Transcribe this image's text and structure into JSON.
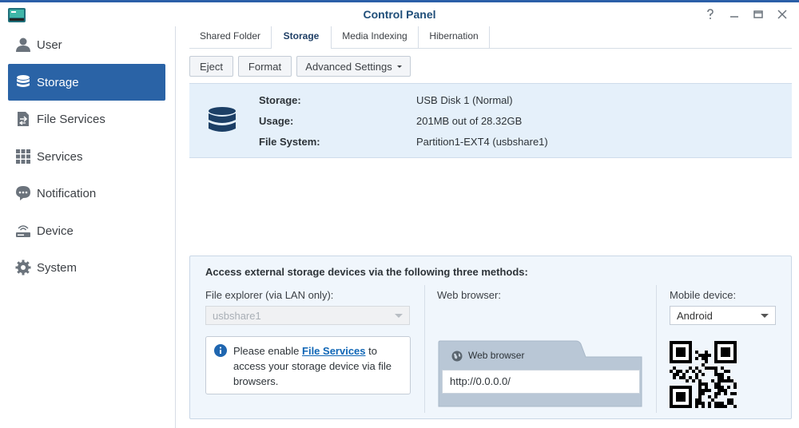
{
  "window": {
    "title": "Control Panel"
  },
  "sidebar": {
    "items": [
      {
        "label": "User",
        "icon": "user-icon"
      },
      {
        "label": "Storage",
        "icon": "database-icon",
        "active": true
      },
      {
        "label": "File Services",
        "icon": "file-services-icon"
      },
      {
        "label": "Services",
        "icon": "grid-icon"
      },
      {
        "label": "Notification",
        "icon": "chat-bubble-icon"
      },
      {
        "label": "Device",
        "icon": "router-icon"
      },
      {
        "label": "System",
        "icon": "gear-icon"
      }
    ]
  },
  "tabs": [
    "Shared Folder",
    "Storage",
    "Media Indexing",
    "Hibernation"
  ],
  "toolbar": {
    "eject": "Eject",
    "format": "Format",
    "advanced": "Advanced Settings"
  },
  "storage_info": {
    "storage_label": "Storage:",
    "storage_value": "USB Disk 1 (Normal)",
    "usage_label": "Usage:",
    "usage_value": "201MB out of 28.32GB",
    "fs_label": "File System:",
    "fs_value": "Partition1-EXT4 (usbshare1)"
  },
  "access": {
    "title": "Access external storage devices via the following three methods:",
    "file_explorer": {
      "label": "File explorer (via LAN only):",
      "selected": "usbshare1",
      "note_before": "Please enable ",
      "note_link": "File Services",
      "note_after": " to access your storage device via file browsers."
    },
    "web_browser": {
      "label": "Web browser:",
      "tab_label": "Web browser",
      "url": "http://0.0.0.0/"
    },
    "mobile": {
      "label": "Mobile device:",
      "selected": "Android"
    }
  },
  "colors": {
    "accent": "#2a63a6",
    "panel": "#e5f0fa",
    "link": "#0f66b6",
    "title": "#1f4e79"
  }
}
